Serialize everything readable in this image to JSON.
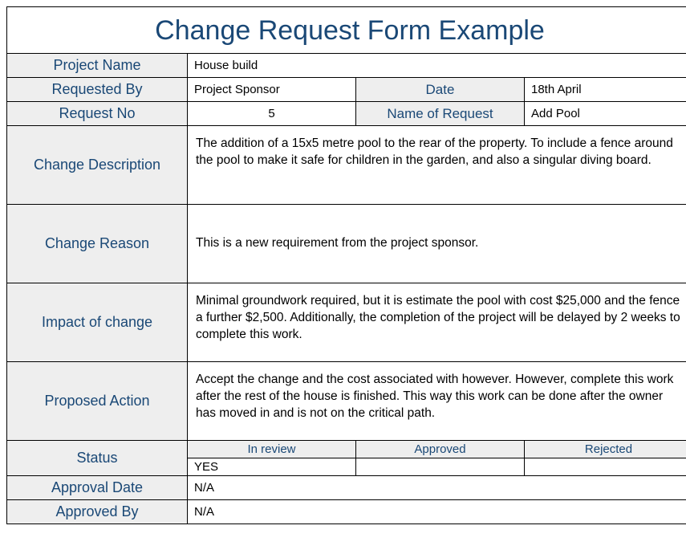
{
  "title": "Change Request Form Example",
  "labels": {
    "project_name": "Project Name",
    "requested_by": "Requested By",
    "date": "Date",
    "request_no": "Request No",
    "name_of_request": "Name of Request",
    "change_description": "Change Description",
    "change_reason": "Change Reason",
    "impact_of_change": "Impact of change",
    "proposed_action": "Proposed Action",
    "status": "Status",
    "approval_date": "Approval Date",
    "approved_by": "Approved By"
  },
  "status_headers": {
    "in_review": "In review",
    "approved": "Approved",
    "rejected": "Rejected"
  },
  "values": {
    "project_name": "House build",
    "requested_by": "Project Sponsor",
    "date": "18th April",
    "request_no": "5",
    "name_of_request": "Add Pool",
    "change_description": "The addition of a 15x5 metre pool to the rear of the property. To include a fence around the pool to make it safe for children in the garden, and also a singular diving board.",
    "change_reason": "This is a new requirement from the project sponsor.",
    "impact_of_change": "Minimal groundwork required, but it is estimate the pool with cost $25,000 and the fence a further $2,500. Additionally, the completion of the project will be delayed by 2 weeks to complete this work.",
    "proposed_action": "Accept the change and the cost associated with however. However, complete this work after the rest of the house is finished. This way this work can be done after the owner has moved in and is not on the critical path.",
    "status_in_review": "YES",
    "status_approved": "",
    "status_rejected": "",
    "approval_date": "N/A",
    "approved_by": "N/A"
  }
}
